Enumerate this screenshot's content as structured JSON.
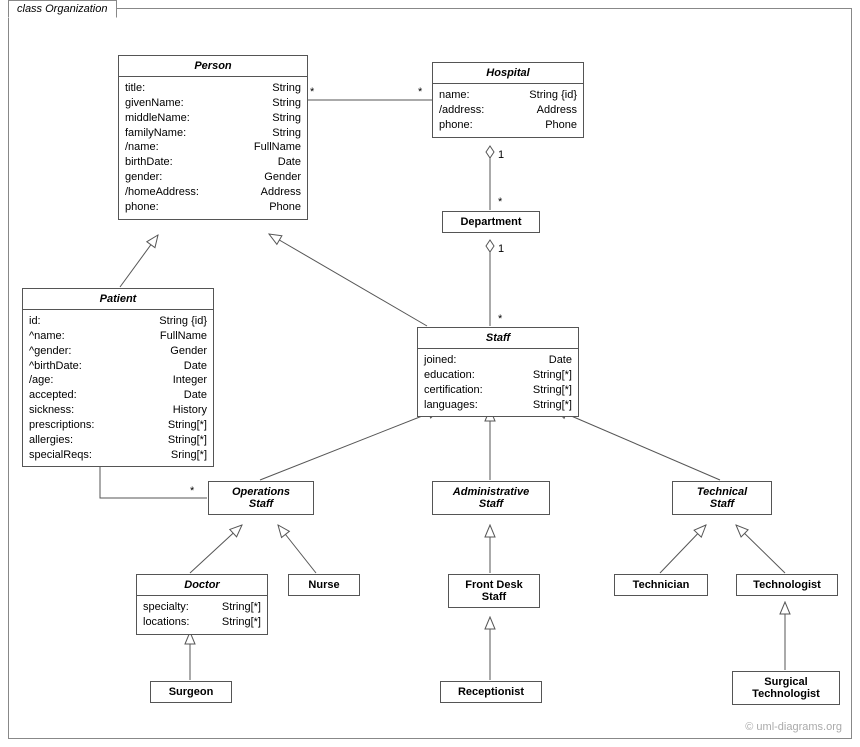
{
  "frame": {
    "title": "class Organization"
  },
  "watermark": "© uml-diagrams.org",
  "mult": {
    "star": "*",
    "one": "1"
  },
  "classes": {
    "person": {
      "name": "Person",
      "attrs": [
        {
          "n": "title:",
          "t": "String"
        },
        {
          "n": "givenName:",
          "t": "String"
        },
        {
          "n": "middleName:",
          "t": "String"
        },
        {
          "n": "familyName:",
          "t": "String"
        },
        {
          "n": "/name:",
          "t": "FullName"
        },
        {
          "n": "birthDate:",
          "t": "Date"
        },
        {
          "n": "gender:",
          "t": "Gender"
        },
        {
          "n": "/homeAddress:",
          "t": "Address"
        },
        {
          "n": "phone:",
          "t": "Phone"
        }
      ]
    },
    "hospital": {
      "name": "Hospital",
      "attrs": [
        {
          "n": "name:",
          "t": "String {id}"
        },
        {
          "n": "/address:",
          "t": "Address"
        },
        {
          "n": "phone:",
          "t": "Phone"
        }
      ]
    },
    "department": {
      "name": "Department"
    },
    "patient": {
      "name": "Patient",
      "attrs": [
        {
          "n": "id:",
          "t": "String {id}"
        },
        {
          "n": "^name:",
          "t": "FullName"
        },
        {
          "n": "^gender:",
          "t": "Gender"
        },
        {
          "n": "^birthDate:",
          "t": "Date"
        },
        {
          "n": "/age:",
          "t": "Integer"
        },
        {
          "n": "accepted:",
          "t": "Date"
        },
        {
          "n": "sickness:",
          "t": "History"
        },
        {
          "n": "prescriptions:",
          "t": "String[*]"
        },
        {
          "n": "allergies:",
          "t": "String[*]"
        },
        {
          "n": "specialReqs:",
          "t": "Sring[*]"
        }
      ]
    },
    "staff": {
      "name": "Staff",
      "attrs": [
        {
          "n": "joined:",
          "t": "Date"
        },
        {
          "n": "education:",
          "t": "String[*]"
        },
        {
          "n": "certification:",
          "t": "String[*]"
        },
        {
          "n": "languages:",
          "t": "String[*]"
        }
      ]
    },
    "opsStaff": {
      "name": "Operations",
      "name2": "Staff"
    },
    "adminStaff": {
      "name": "Administrative",
      "name2": "Staff"
    },
    "techStaff": {
      "name": "Technical",
      "name2": "Staff"
    },
    "doctor": {
      "name": "Doctor",
      "attrs": [
        {
          "n": "specialty:",
          "t": "String[*]"
        },
        {
          "n": "locations:",
          "t": "String[*]"
        }
      ]
    },
    "nurse": {
      "name": "Nurse"
    },
    "frontDesk": {
      "name": "Front Desk",
      "name2": "Staff"
    },
    "technician": {
      "name": "Technician"
    },
    "technologist": {
      "name": "Technologist"
    },
    "surgeon": {
      "name": "Surgeon"
    },
    "receptionist": {
      "name": "Receptionist"
    },
    "surgTech": {
      "name": "Surgical",
      "name2": "Technologist"
    }
  }
}
